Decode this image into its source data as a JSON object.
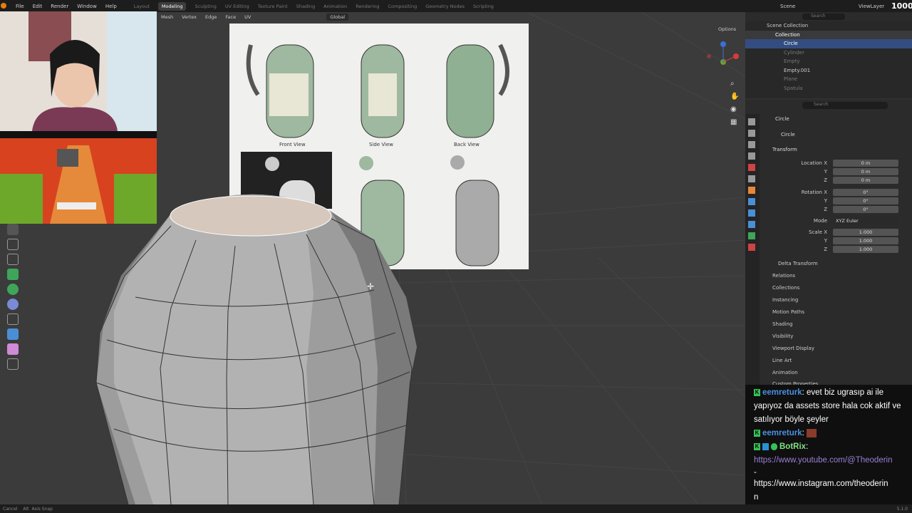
{
  "menu": {
    "items": [
      "File",
      "Edit",
      "Render",
      "Window",
      "Help"
    ]
  },
  "workspaces": {
    "tabs": [
      "Layout",
      "Modeling",
      "Sculpting",
      "UV Editing",
      "Texture Paint",
      "Shading",
      "Animation",
      "Rendering",
      "Compositing",
      "Geometry Nodes",
      "Scripting"
    ],
    "active": "Modeling"
  },
  "topright": {
    "scene": "Scene",
    "viewlayer": "ViewLayer",
    "counter": "1000"
  },
  "viewport_header": {
    "items": [
      "Mesh",
      "Vertex",
      "Edge",
      "Face",
      "UV"
    ],
    "orientation": "Global",
    "options": "Options"
  },
  "reference": {
    "front": "Front View",
    "side": "Side View",
    "back": "Back View"
  },
  "outliner": {
    "search_placeholder": "Search",
    "root": "Scene Collection",
    "collection": "Collection",
    "items": [
      "Circle",
      "Cylinder",
      "Empty",
      "Empty.001",
      "Plane",
      "Spatula"
    ]
  },
  "properties": {
    "search_placeholder": "Search",
    "object": "Circle",
    "object_field": "Circle",
    "transform": "Transform",
    "location_x_label": "Location X",
    "loc_x": "0 m",
    "y_label": "Y",
    "loc_y": "0 m",
    "z_label": "Z",
    "loc_z": "0 m",
    "rotation_x_label": "Rotation X",
    "rot_x": "0°",
    "rot_y": "0°",
    "rot_z": "0°",
    "mode_label": "Mode",
    "mode_value": "XYZ Euler",
    "scale_x_label": "Scale X",
    "scale_x": "1.000",
    "scale_y": "1.000",
    "scale_z": "1.000",
    "panels": [
      "Delta Transform",
      "Relations",
      "Collections",
      "Instancing",
      "Motion Paths",
      "Shading",
      "Visibility",
      "Viewport Display",
      "Line Art",
      "Animation",
      "Custom Properties"
    ]
  },
  "chat": {
    "m1_user": "eemreturk",
    "m1_text": ": evet biz ugrasıp ai ile yapıyoz da assets store hala cok aktif ve satılıyor böyle şeyler",
    "m2_user": "eemreturk",
    "m2_text": ":",
    "m3_user": "BotRix",
    "m3_text": ":",
    "link1": "https://www.youtube.com/@Theoderin",
    "dash": "-",
    "link2": "https://www.instagram.com/theoderin",
    "tail": "n"
  },
  "status": {
    "cancel": "Cancel",
    "alt": "Alt",
    "snap": "Axis Snap",
    "version": "5.1.0"
  }
}
